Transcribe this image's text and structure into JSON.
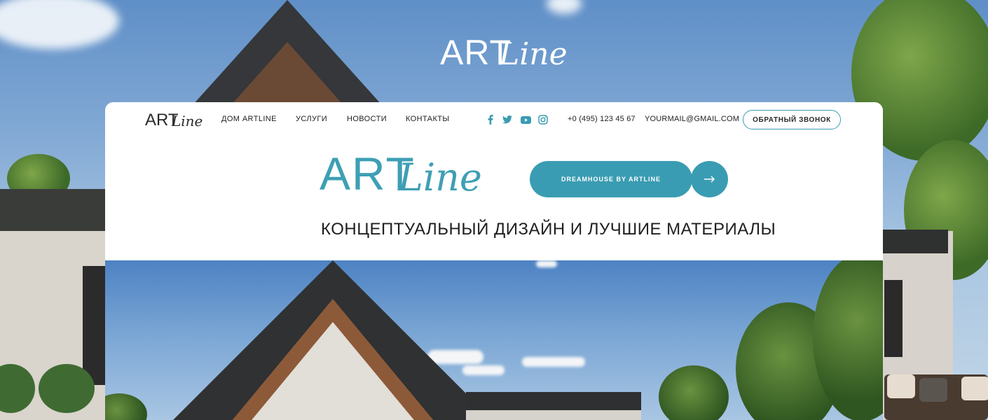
{
  "brand": {
    "logo_art": "ART",
    "logo_line": "Line"
  },
  "nav": {
    "links": [
      "ДОМ ARTLINE",
      "УСЛУГИ",
      "НОВОСТИ",
      "КОНТАКТЫ"
    ],
    "social_icons": [
      "facebook-icon",
      "twitter-icon",
      "youtube-icon",
      "instagram-icon"
    ],
    "phone": "+0 (495) 123 45 67",
    "email": "YOURMAIL@GMAIL.COM",
    "callback_label": "ОБРАТНЫЙ ЗВОНОК"
  },
  "hero": {
    "button_label": "DREAMHOUSE BY ARTLINE",
    "arrow": "→",
    "tagline": "КОНЦЕПТУАЛЬНЫЙ ДИЗАЙН И ЛУЧШИЕ МАТЕРИАЛЫ"
  },
  "colors": {
    "accent": "#3a9cb2",
    "text": "#222222",
    "card_bg": "#ffffff"
  }
}
